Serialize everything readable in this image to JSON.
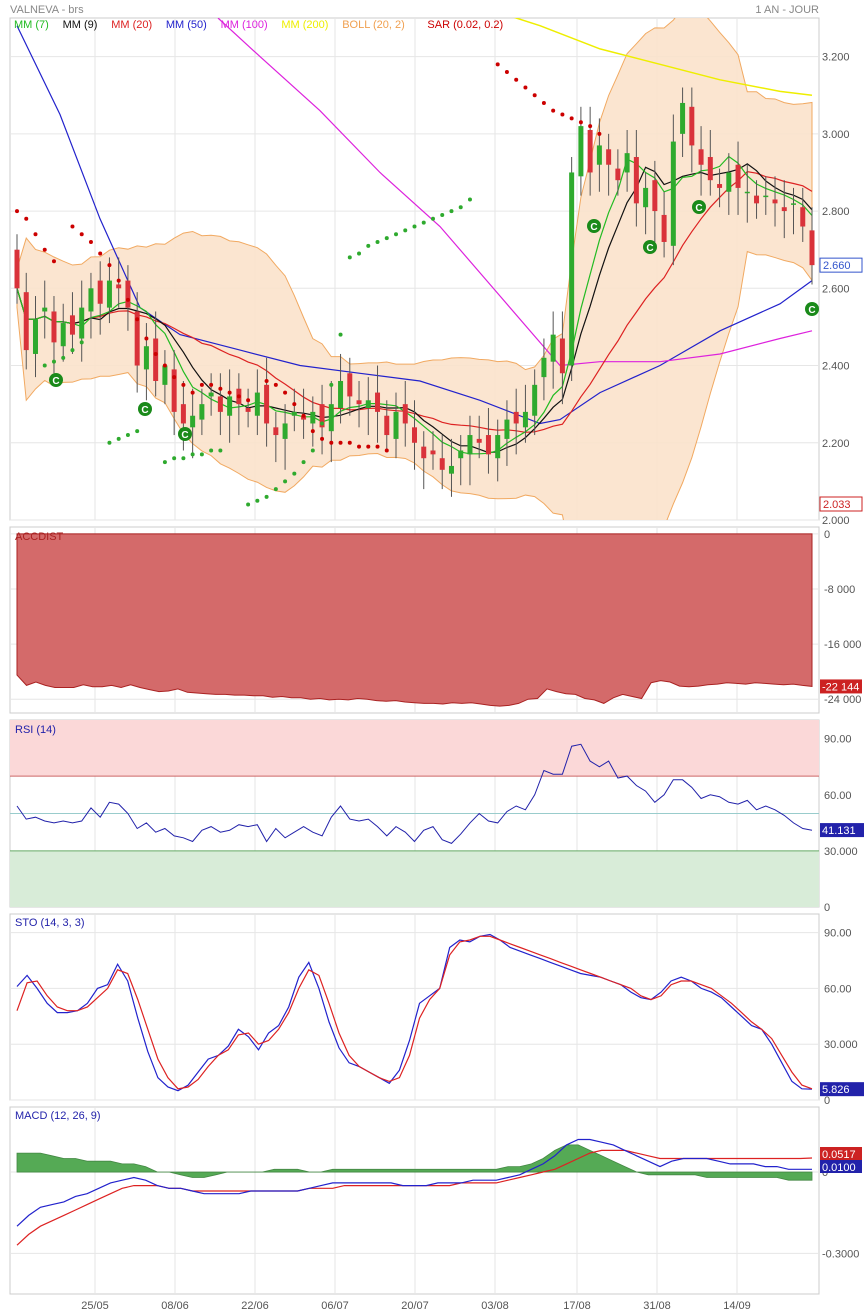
{
  "header": {
    "ticker": "VALNEVA - brs",
    "period": "1 AN - JOUR"
  },
  "colors": {
    "up": "#2eaa2e",
    "down": "#d9323a",
    "mm7": "#22bb22",
    "mm9": "#111111",
    "mm20": "#dd2222",
    "mm50": "#2222cc",
    "mm100": "#dd22dd",
    "mm200": "#eeee00",
    "boll": "#f0a050",
    "sar": "#cc0000",
    "accdist": "#d46a6a",
    "rsi": "#2222aa",
    "macd_hist": "#55aa55"
  },
  "chart_data": [
    {
      "type": "candlestick",
      "panel": "price",
      "legend": [
        {
          "label": "MM (7)",
          "color": "#22bb22"
        },
        {
          "label": "MM (9)",
          "color": "#111111"
        },
        {
          "label": "MM (20)",
          "color": "#dd2222"
        },
        {
          "label": "MM (50)",
          "color": "#2222cc"
        },
        {
          "label": "MM (100)",
          "color": "#dd22dd"
        },
        {
          "label": "MM (200)",
          "color": "#eeee00"
        },
        {
          "label": "BOLL (20, 2)",
          "color": "#f0a050"
        },
        {
          "label": "SAR (0.02, 0.2)",
          "color": "#cc0000"
        }
      ],
      "x_ticks": [
        "25/05",
        "08/06",
        "22/06",
        "06/07",
        "20/07",
        "03/08",
        "17/08",
        "31/08",
        "14/09"
      ],
      "y_ticks": [
        "3.200",
        "3.000",
        "2.800",
        "2.600",
        "2.400",
        "2.200",
        "2.000"
      ],
      "ylim": [
        2.0,
        3.3
      ],
      "last_price": "2.660",
      "low_marker": "2.033",
      "signal_label": "C",
      "closes": [
        2.6,
        2.44,
        2.52,
        2.55,
        2.46,
        2.51,
        2.48,
        2.55,
        2.6,
        2.56,
        2.62,
        2.6,
        2.55,
        2.4,
        2.45,
        2.36,
        2.4,
        2.28,
        2.25,
        2.27,
        2.3,
        2.33,
        2.28,
        2.32,
        2.3,
        2.28,
        2.33,
        2.25,
        2.22,
        2.25,
        2.28,
        2.26,
        2.28,
        2.24,
        2.3,
        2.36,
        2.32,
        2.3,
        2.31,
        2.28,
        2.22,
        2.28,
        2.25,
        2.2,
        2.16,
        2.17,
        2.13,
        2.14,
        2.18,
        2.22,
        2.2,
        2.17,
        2.22,
        2.26,
        2.25,
        2.28,
        2.35,
        2.42,
        2.48,
        2.38,
        2.9,
        3.02,
        2.9,
        2.97,
        2.92,
        2.88,
        2.95,
        2.82,
        2.86,
        2.8,
        2.72,
        2.98,
        3.08,
        2.97,
        2.92,
        2.88,
        2.86,
        2.9,
        2.86,
        2.85,
        2.82,
        2.84,
        2.82,
        2.8,
        2.82,
        2.76,
        2.66
      ],
      "sar_down": [
        [
          0,
          2.8
        ],
        [
          1,
          2.78
        ],
        [
          2,
          2.74
        ],
        [
          3,
          2.7
        ],
        [
          4,
          2.67
        ],
        [
          6,
          2.76
        ],
        [
          7,
          2.74
        ],
        [
          8,
          2.72
        ],
        [
          9,
          2.69
        ],
        [
          10,
          2.66
        ],
        [
          11,
          2.62
        ],
        [
          12,
          2.57
        ],
        [
          13,
          2.52
        ],
        [
          14,
          2.47
        ],
        [
          15,
          2.43
        ],
        [
          16,
          2.4
        ],
        [
          17,
          2.37
        ],
        [
          18,
          2.35
        ],
        [
          19,
          2.33
        ],
        [
          20,
          2.35
        ],
        [
          21,
          2.35
        ],
        [
          22,
          2.34
        ],
        [
          23,
          2.33
        ],
        [
          24,
          2.32
        ],
        [
          25,
          2.31
        ],
        [
          27,
          2.36
        ],
        [
          28,
          2.35
        ],
        [
          29,
          2.33
        ],
        [
          30,
          2.3
        ],
        [
          31,
          2.27
        ],
        [
          32,
          2.23
        ],
        [
          33,
          2.21
        ],
        [
          34,
          2.2
        ],
        [
          35,
          2.2
        ],
        [
          36,
          2.2
        ],
        [
          37,
          2.19
        ],
        [
          38,
          2.19
        ],
        [
          39,
          2.19
        ],
        [
          40,
          2.18
        ],
        [
          52,
          3.18
        ],
        [
          53,
          3.16
        ],
        [
          54,
          3.14
        ],
        [
          55,
          3.12
        ],
        [
          56,
          3.1
        ],
        [
          57,
          3.08
        ],
        [
          58,
          3.06
        ],
        [
          59,
          3.05
        ],
        [
          60,
          3.04
        ],
        [
          61,
          3.03
        ],
        [
          62,
          3.02
        ],
        [
          63,
          3.0
        ]
      ],
      "sar_up": [
        [
          3,
          2.4
        ],
        [
          4,
          2.41
        ],
        [
          5,
          2.42
        ],
        [
          6,
          2.44
        ],
        [
          7,
          2.46
        ],
        [
          10,
          2.2
        ],
        [
          11,
          2.21
        ],
        [
          12,
          2.22
        ],
        [
          13,
          2.23
        ],
        [
          16,
          2.15
        ],
        [
          17,
          2.16
        ],
        [
          18,
          2.16
        ],
        [
          19,
          2.17
        ],
        [
          20,
          2.17
        ],
        [
          21,
          2.18
        ],
        [
          22,
          2.18
        ],
        [
          25,
          2.04
        ],
        [
          26,
          2.05
        ],
        [
          27,
          2.06
        ],
        [
          28,
          2.08
        ],
        [
          29,
          2.1
        ],
        [
          30,
          2.12
        ],
        [
          31,
          2.15
        ],
        [
          32,
          2.18
        ],
        [
          33,
          2.25
        ],
        [
          34,
          2.35
        ],
        [
          35,
          2.48
        ],
        [
          36,
          2.68
        ],
        [
          37,
          2.69
        ],
        [
          38,
          2.71
        ],
        [
          39,
          2.72
        ],
        [
          40,
          2.73
        ],
        [
          41,
          2.74
        ],
        [
          42,
          2.75
        ],
        [
          43,
          2.76
        ],
        [
          44,
          2.77
        ],
        [
          45,
          2.78
        ],
        [
          46,
          2.79
        ],
        [
          47,
          2.8
        ],
        [
          48,
          2.81
        ],
        [
          49,
          2.83
        ]
      ]
    },
    {
      "type": "area",
      "panel": "indicator",
      "title": "ACCDIST",
      "y_ticks": [
        "0",
        "-8 000",
        "-16 000",
        "-24 000"
      ],
      "ylim": [
        -26000,
        1000
      ],
      "last_value": "-22 144",
      "values": [
        -20500,
        -22000,
        -21500,
        -22000,
        -22300,
        -22300,
        -22300,
        -21900,
        -22200,
        -22200,
        -22000,
        -22300,
        -21900,
        -22300,
        -22600,
        -22900,
        -22800,
        -22500,
        -23000,
        -23100,
        -23200,
        -23300,
        -23300,
        -23400,
        -23400,
        -23500,
        -23500,
        -23700,
        -23600,
        -23800,
        -23800,
        -24000,
        -23900,
        -24100,
        -24000,
        -24100,
        -23900,
        -24000,
        -24200,
        -24300,
        -24200,
        -24400,
        -24500,
        -24600,
        -24600,
        -24700,
        -24500,
        -24600,
        -24500,
        -24700,
        -24900,
        -25000,
        -24900,
        -24600,
        -24000,
        -23900,
        -22500,
        -22900,
        -23200,
        -23300,
        -23900,
        -24100,
        -24600,
        -23800,
        -23300,
        -23600,
        -23900,
        -21600,
        -21300,
        -21500,
        -22100,
        -22200,
        -22100,
        -21900,
        -21800,
        -21600,
        -21700,
        -21800,
        -21600,
        -21700,
        -21800,
        -21900,
        -21800,
        -22000,
        -22144
      ]
    },
    {
      "type": "line",
      "panel": "indicator",
      "title": "RSI (14)",
      "y_ticks": [
        "90.00",
        "60.00",
        "30.000",
        "0"
      ],
      "ylim": [
        0,
        100
      ],
      "overbought": 70,
      "oversold": 30,
      "midline": 50,
      "last_value": "41.131",
      "values": [
        54,
        47,
        48,
        46,
        45,
        46,
        45,
        46,
        53,
        48,
        56,
        55,
        50,
        42,
        45,
        40,
        42,
        38,
        37,
        35,
        41,
        43,
        40,
        41,
        44,
        43,
        44,
        35,
        42,
        37,
        40,
        43,
        40,
        38,
        48,
        54,
        47,
        46,
        47,
        43,
        38,
        43,
        40,
        35,
        41,
        43,
        36,
        34,
        39,
        45,
        50,
        46,
        45,
        51,
        54,
        52,
        60,
        73,
        71,
        71,
        86,
        87,
        78,
        75,
        78,
        69,
        70,
        65,
        62,
        56,
        60,
        68,
        68,
        64,
        58,
        60,
        59,
        56,
        55,
        57,
        52,
        54,
        52,
        49,
        45,
        42,
        41
      ]
    },
    {
      "type": "line",
      "panel": "indicator",
      "title": "STO (14, 3, 3)",
      "y_ticks": [
        "90.00",
        "60.00",
        "30.000",
        "0"
      ],
      "ylim": [
        0,
        100
      ],
      "last_value": "5.826",
      "series": [
        {
          "color": "#2222cc",
          "values": [
            61,
            67,
            60,
            52,
            47,
            47,
            48,
            52,
            60,
            62,
            73,
            64,
            44,
            26,
            12,
            7,
            5,
            8,
            15,
            22,
            24,
            29,
            38,
            34,
            27,
            36,
            40,
            50,
            66,
            74,
            60,
            42,
            28,
            20,
            18,
            15,
            12,
            9,
            16,
            32,
            52,
            56,
            60,
            82,
            86,
            85,
            88,
            89,
            86,
            82,
            80,
            78,
            76,
            74,
            72,
            70,
            68,
            67,
            66,
            64,
            62,
            58,
            55,
            54,
            58,
            64,
            66,
            64,
            60,
            58,
            55,
            50,
            45,
            40,
            38,
            30,
            20,
            10,
            6,
            5.826
          ]
        },
        {
          "color": "#dd2222",
          "values": [
            48,
            63,
            64,
            56,
            50,
            48,
            48,
            50,
            55,
            60,
            70,
            68,
            54,
            38,
            22,
            12,
            6,
            7,
            11,
            18,
            24,
            27,
            35,
            36,
            30,
            32,
            38,
            47,
            60,
            70,
            67,
            52,
            36,
            24,
            18,
            15,
            12,
            10,
            12,
            24,
            44,
            54,
            60,
            78,
            85,
            86,
            88,
            88,
            86,
            84,
            82,
            80,
            78,
            76,
            74,
            72,
            70,
            68,
            66,
            64,
            62,
            60,
            56,
            54,
            56,
            62,
            64,
            64,
            62,
            60,
            56,
            52,
            47,
            42,
            38,
            33,
            24,
            15,
            8,
            6
          ]
        }
      ]
    },
    {
      "type": "line",
      "panel": "indicator",
      "title": "MACD (12, 26, 9)",
      "y_ticks": [
        "0",
        "-0.3000"
      ],
      "ylim": [
        -0.45,
        0.24
      ],
      "last_values": [
        "0.0517",
        "0.0100"
      ],
      "macd": [
        -0.2,
        -0.16,
        -0.13,
        -0.12,
        -0.11,
        -0.09,
        -0.08,
        -0.06,
        -0.04,
        -0.03,
        -0.02,
        -0.03,
        -0.05,
        -0.06,
        -0.06,
        -0.07,
        -0.08,
        -0.08,
        -0.08,
        -0.08,
        -0.07,
        -0.07,
        -0.07,
        -0.07,
        -0.07,
        -0.06,
        -0.05,
        -0.04,
        -0.04,
        -0.04,
        -0.04,
        -0.04,
        -0.04,
        -0.05,
        -0.05,
        -0.05,
        -0.04,
        -0.04,
        -0.04,
        -0.03,
        -0.03,
        -0.03,
        -0.02,
        -0.01,
        0.01,
        0.03,
        0.06,
        0.1,
        0.12,
        0.12,
        0.11,
        0.1,
        0.08,
        0.06,
        0.04,
        0.02,
        0.04,
        0.05,
        0.05,
        0.05,
        0.04,
        0.03,
        0.03,
        0.03,
        0.02,
        0.02,
        0.01,
        0.01,
        0.01
      ],
      "signal": [
        -0.27,
        -0.23,
        -0.2,
        -0.18,
        -0.16,
        -0.14,
        -0.12,
        -0.1,
        -0.08,
        -0.06,
        -0.05,
        -0.05,
        -0.05,
        -0.06,
        -0.06,
        -0.07,
        -0.07,
        -0.07,
        -0.07,
        -0.07,
        -0.07,
        -0.07,
        -0.07,
        -0.07,
        -0.07,
        -0.06,
        -0.06,
        -0.06,
        -0.05,
        -0.05,
        -0.05,
        -0.05,
        -0.05,
        -0.05,
        -0.05,
        -0.05,
        -0.05,
        -0.05,
        -0.04,
        -0.04,
        -0.04,
        -0.04,
        -0.03,
        -0.02,
        -0.01,
        0.0,
        0.01,
        0.03,
        0.05,
        0.07,
        0.08,
        0.08,
        0.08,
        0.07,
        0.06,
        0.05,
        0.05,
        0.05,
        0.05,
        0.05,
        0.05,
        0.05,
        0.05,
        0.05,
        0.05,
        0.05,
        0.05,
        0.05,
        0.0517
      ],
      "histogram": [
        0.07,
        0.07,
        0.07,
        0.06,
        0.05,
        0.05,
        0.04,
        0.04,
        0.04,
        0.03,
        0.03,
        0.02,
        0.0,
        0.0,
        -0.01,
        -0.02,
        -0.02,
        -0.01,
        0.0,
        0.0,
        0.0,
        0.0,
        0.01,
        0.01,
        0.01,
        0.0,
        0.0,
        0.01,
        0.01,
        0.01,
        0.01,
        0.01,
        0.01,
        0.01,
        0.01,
        0.01,
        0.01,
        0.01,
        0.01,
        0.01,
        0.01,
        0.01,
        0.02,
        0.02,
        0.03,
        0.05,
        0.08,
        0.1,
        0.1,
        0.08,
        0.06,
        0.04,
        0.02,
        0.0,
        -0.01,
        -0.01,
        -0.01,
        -0.01,
        -0.01,
        -0.02,
        -0.02,
        -0.02,
        -0.02,
        -0.02,
        -0.02,
        -0.02,
        -0.03,
        -0.03,
        -0.03
      ]
    }
  ]
}
